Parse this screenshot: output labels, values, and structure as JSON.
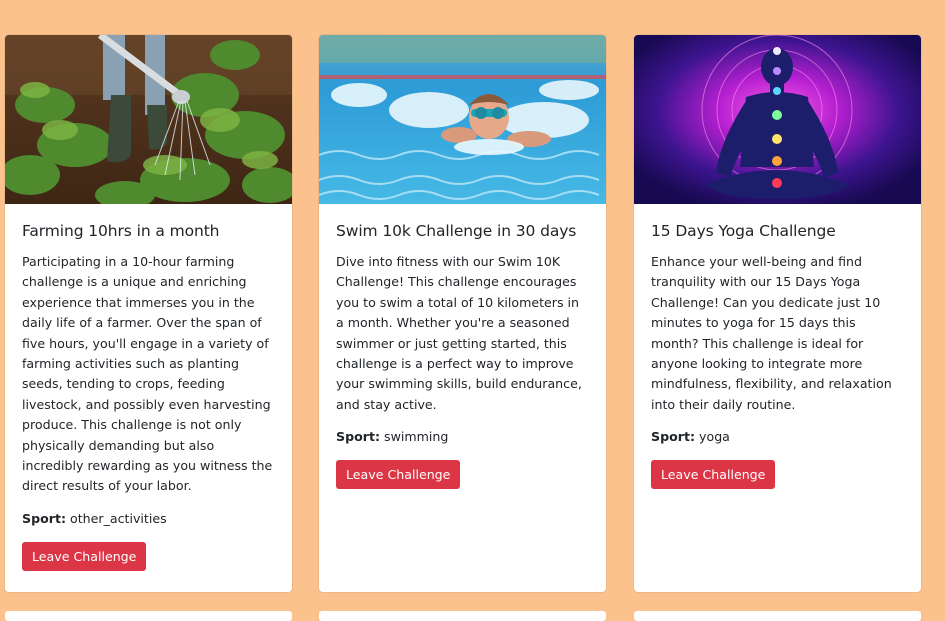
{
  "cards": [
    {
      "title": "Farming 10hrs in a month",
      "description": "Participating in a 10-hour farming challenge is a unique and enriching experience that immerses you in the daily life of a farmer. Over the span of five hours, you'll engage in a variety of farming activities such as planting seeds, tending to crops, feeding livestock, and possibly even harvesting produce. This challenge is not only physically demanding but also incredibly rewarding as you witness the direct results of your labor.",
      "sport_label": "Sport:",
      "sport_value": "other_activities",
      "button_label": "Leave Challenge",
      "image": "farmer-watering-plants"
    },
    {
      "title": "Swim 10k Challenge in 30 days",
      "description": "Dive into fitness with our Swim 10K Challenge! This challenge encourages you to swim a total of 10 kilometers in a month. Whether you're a seasoned swimmer or just getting started, this challenge is a perfect way to improve your swimming skills, build endurance, and stay active.",
      "sport_label": "Sport:",
      "sport_value": "swimming",
      "button_label": "Leave Challenge",
      "image": "boy-swimming-pool"
    },
    {
      "title": "15 Days Yoga Challenge",
      "description": "Enhance your well-being and find tranquility with our 15 Days Yoga Challenge! Can you dedicate just 10 minutes to yoga for 15 days this month? This challenge is ideal for anyone looking to integrate more mindfulness, flexibility, and relaxation into their daily routine.",
      "sport_label": "Sport:",
      "sport_value": "yoga",
      "button_label": "Leave Challenge",
      "image": "meditation-chakras"
    }
  ],
  "colors": {
    "background": "#fbc28e",
    "card": "#ffffff",
    "danger": "#dc3545",
    "text": "#212529"
  }
}
